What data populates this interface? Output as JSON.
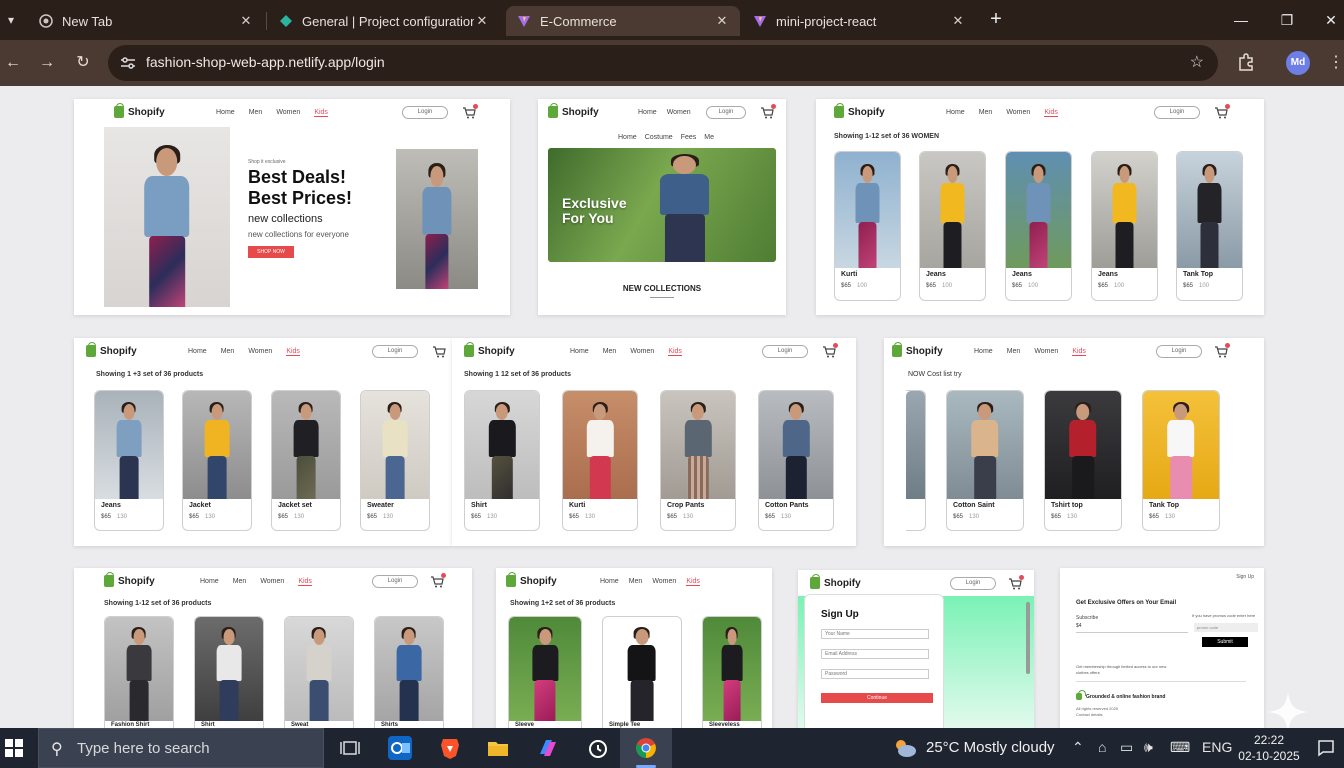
{
  "browser": {
    "tabs": [
      {
        "label": "New Tab",
        "active": false
      },
      {
        "label": "General | Project configuration",
        "active": false
      },
      {
        "label": "E-Commerce",
        "active": true
      },
      {
        "label": "mini-project-react",
        "active": false
      }
    ],
    "url": "fashion-shop-web-app.netlify.app/login",
    "profile_initials": "Md"
  },
  "site": {
    "brand": "Shopify",
    "nav": [
      "Home",
      "Men",
      "Women",
      "Kids"
    ],
    "login": "Login",
    "accent_color": "#e64a5a",
    "brand_color": "#5ea83a"
  },
  "thumbs": {
    "hero": {
      "kicker": "Shop it exclusive",
      "title_line1": "Best Deals!",
      "title_line2": "Best Prices!",
      "sub": "new collections",
      "desc": "new collections for everyone",
      "cta": "SHOP NOW"
    },
    "banner": {
      "subnav": [
        "Home",
        "Costume",
        "Fees",
        "Me"
      ],
      "line1": "Exclusive",
      "line2": "For You",
      "caption": "NEW COLLECTIONS"
    },
    "kids_set": {
      "showing": "Showing 1-12 set of 36 WOMEN",
      "items": [
        {
          "name": "Kurti",
          "price": "$65",
          "old": "100"
        },
        {
          "name": "Jeans",
          "price": "$65",
          "old": "100"
        },
        {
          "name": "Jeans",
          "price": "$65",
          "old": "100"
        },
        {
          "name": "Jeans",
          "price": "$65",
          "old": "100"
        },
        {
          "name": "Tank Top",
          "price": "$65",
          "old": "100"
        }
      ]
    },
    "men_set": {
      "showing": "Showing 1 +3 set of 36 products",
      "items": [
        {
          "name": "Jeans",
          "price": "$65",
          "old": "130"
        },
        {
          "name": "Jacket",
          "price": "$65",
          "old": "130"
        },
        {
          "name": "Jacket set",
          "price": "$65",
          "old": "130"
        },
        {
          "name": "Sweater",
          "price": "$65",
          "old": "130"
        }
      ]
    },
    "kids2_set": {
      "showing": "Showing 1 12 set of 36 products",
      "items": [
        {
          "name": "Shirt",
          "price": "$65",
          "old": "130"
        },
        {
          "name": "Kurti",
          "price": "$65",
          "old": "130"
        },
        {
          "name": "Crop Pants",
          "price": "$65",
          "old": "130"
        },
        {
          "name": "Cotton Pants",
          "price": "$65",
          "old": "130"
        }
      ]
    },
    "new_set": {
      "showing": "NOW Cost list try",
      "items": [
        {
          "name": "Cotton Saint",
          "price": "$65",
          "old": "130"
        },
        {
          "name": "Tshirt top",
          "price": "$65",
          "old": "130"
        },
        {
          "name": "Tank Top",
          "price": "$65",
          "old": "130"
        }
      ]
    },
    "men2_set": {
      "showing": "Showing 1-12 set of 36 products",
      "items": [
        {
          "name": "Fashion Shirt"
        },
        {
          "name": "Shirt"
        },
        {
          "name": "Sweat"
        },
        {
          "name": "Shirts"
        }
      ]
    },
    "kids3_set": {
      "showing": "Showing 1+2 set of 36 products",
      "items": [
        {
          "name": "Sleeve"
        },
        {
          "name": "Simple Tee"
        },
        {
          "name": "Sleeveless"
        }
      ]
    },
    "signup": {
      "title": "Sign Up",
      "fields": [
        "Your Name",
        "Email Address",
        "Password"
      ],
      "button": "Continue"
    },
    "footer": {
      "corner": "Sign Up",
      "heading": "Get Exclusive Offers on Your Email",
      "label": "Subscribe",
      "input_value": "$4",
      "right_label": "If you have promos code enter here",
      "right_input": "promo code",
      "submit": "Submit",
      "line1": "Get membership through limited access to our new",
      "line2": "clothes offers",
      "brand_line": "Grounded & online fashion brand",
      "small1": "All rights reserved 2025",
      "small2": "Contact details"
    }
  },
  "taskbar": {
    "search_placeholder": "Type here to search",
    "weather": "25°C  Mostly cloudy",
    "lang": "ENG",
    "time": "22:22",
    "date": "02-10-2025"
  }
}
